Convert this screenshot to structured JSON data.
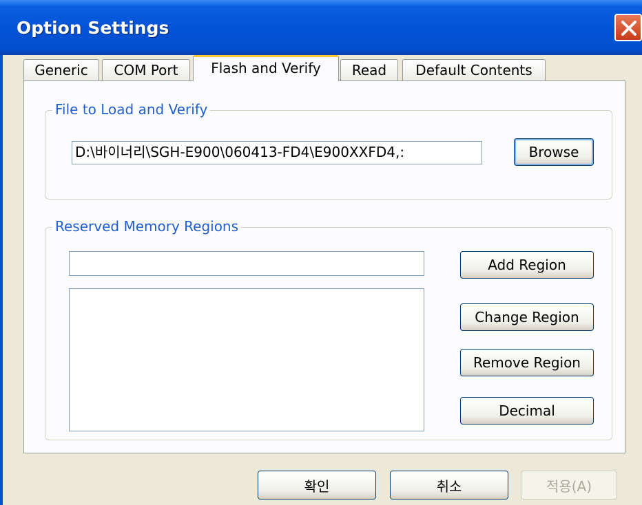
{
  "window": {
    "title": "Option Settings"
  },
  "tabs": [
    {
      "label": "Generic"
    },
    {
      "label": "COM Port"
    },
    {
      "label": "Flash and Verify"
    },
    {
      "label": "Read"
    },
    {
      "label": "Default Contents"
    }
  ],
  "active_tab": "Flash and Verify",
  "file_group": {
    "label": "File to Load and Verify",
    "path_value": "D:\\바이너리\\SGH-E900\\060413-FD4\\E900XXFD4,:",
    "browse_label": "Browse"
  },
  "memory_group": {
    "label": "Reserved Memory Regions",
    "region_input_value": "",
    "regions": [],
    "add_label": "Add Region",
    "change_label": "Change Region",
    "remove_label": "Remove Region",
    "decimal_label": "Decimal"
  },
  "footer": {
    "ok_label": "확인",
    "cancel_label": "취소",
    "apply_label": "적용(A)"
  },
  "colors": {
    "title_bar": "#0453D6",
    "group_label": "#1F5FCF",
    "close_button": "#D5532C",
    "active_tab_highlight": "#FFC83C"
  }
}
